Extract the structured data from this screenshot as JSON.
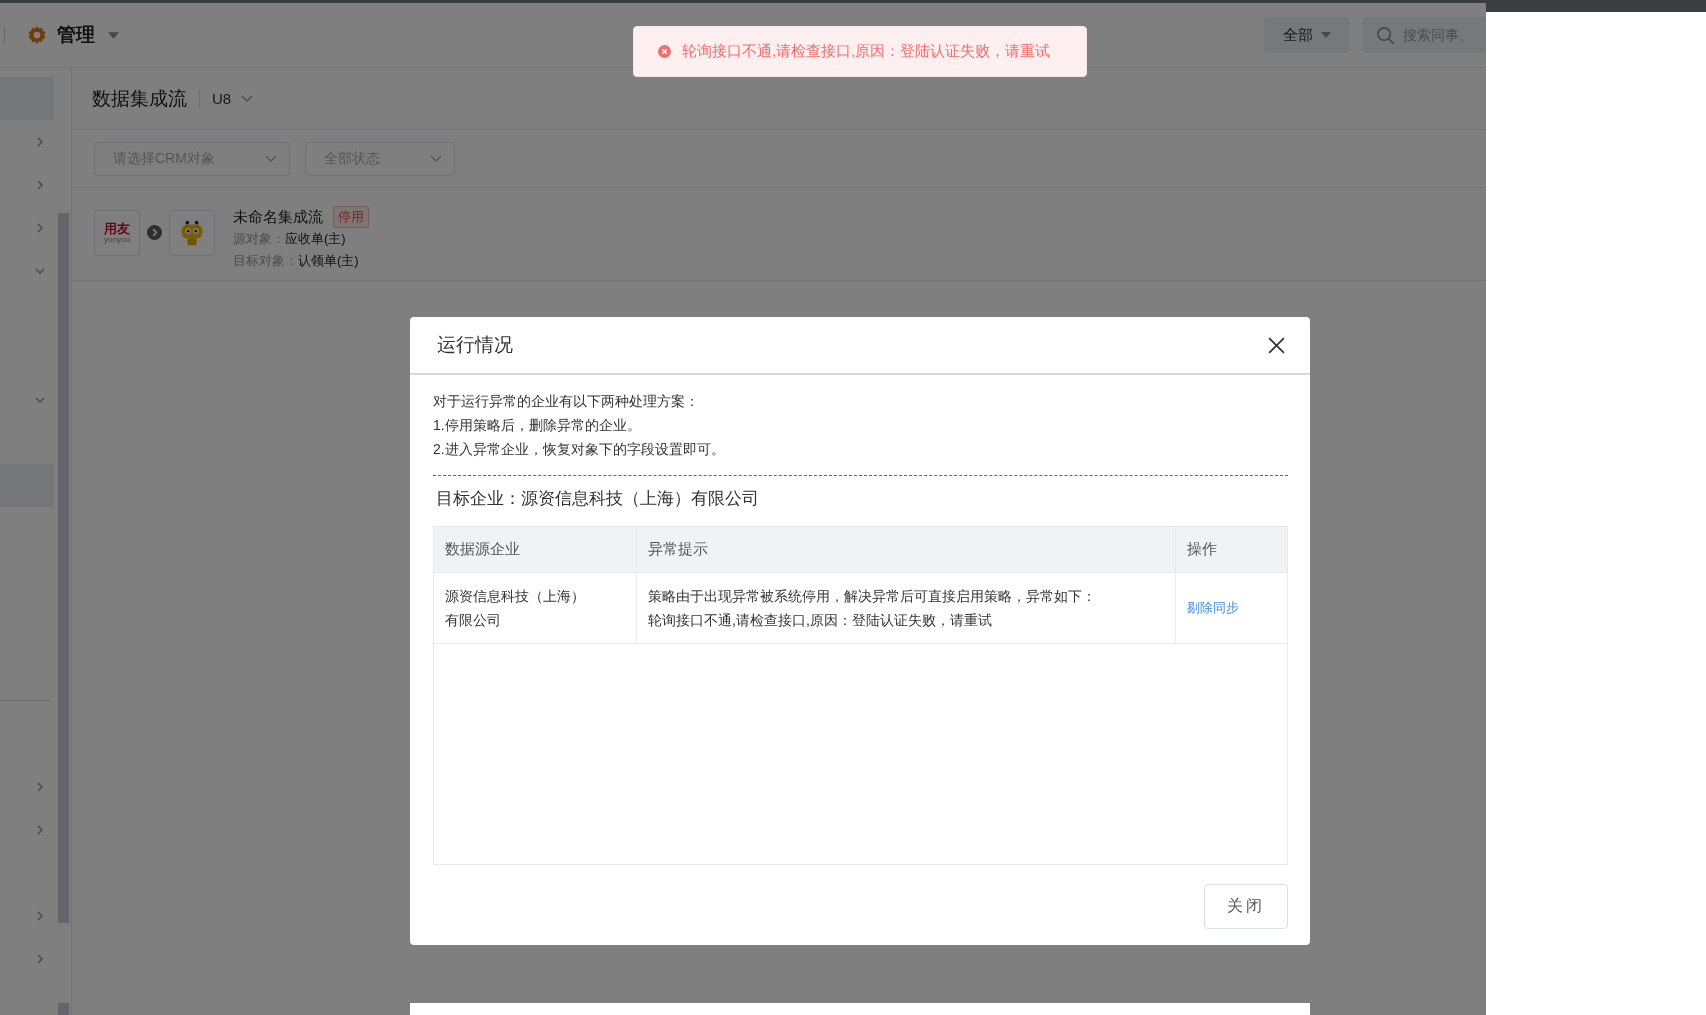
{
  "header": {
    "title": "管理",
    "scope_filter": "全部",
    "search": {
      "placeholder": "搜索同事、"
    }
  },
  "toast": {
    "kind": "error",
    "message": "轮询接口不通,请检查接口,原因：登陆认证失败，请重试"
  },
  "sidebar": {
    "items": [
      {
        "kind": "plain",
        "selected": true
      },
      {
        "kind": "group",
        "selected": false,
        "expanded": false
      },
      {
        "kind": "group",
        "selected": false,
        "expanded": false
      },
      {
        "kind": "group",
        "selected": false,
        "expanded": false
      },
      {
        "kind": "group",
        "selected": false,
        "expanded": true
      },
      {
        "kind": "plain",
        "selected": false
      },
      {
        "kind": "plain",
        "selected": false
      },
      {
        "kind": "group",
        "selected": false,
        "expanded": true
      },
      {
        "kind": "plain",
        "selected": false
      },
      {
        "kind": "plain",
        "selected": true
      },
      {
        "kind": "plain",
        "selected": false
      },
      {
        "kind": "plain",
        "selected": false
      },
      {
        "kind": "plain",
        "selected": false
      },
      {
        "kind": "plain",
        "selected": false
      },
      {
        "kind": "divider"
      },
      {
        "kind": "plain",
        "selected": false
      },
      {
        "kind": "group",
        "selected": false,
        "expanded": false
      },
      {
        "kind": "group",
        "selected": false,
        "expanded": false
      },
      {
        "kind": "plain",
        "selected": false
      },
      {
        "kind": "group",
        "selected": false,
        "expanded": false
      },
      {
        "kind": "group",
        "selected": false,
        "expanded": false
      }
    ]
  },
  "page": {
    "title": "数据集成流",
    "system": "U8",
    "filters": [
      {
        "placeholder": "请选择CRM对象"
      },
      {
        "placeholder": "全部状态"
      }
    ],
    "flows": [
      {
        "source_logo": {
          "text": "用友",
          "subtext": "yonyou"
        },
        "name": "未命名集成流",
        "status": "停用",
        "enabled": false,
        "fields": [
          {
            "label": "源对象：",
            "value": "应收单(主)"
          },
          {
            "label": "目标对象：",
            "value": "认领单(主)"
          }
        ]
      }
    ]
  },
  "dialog": {
    "title": "运行情况",
    "instructions": [
      "对于运行异常的企业有以下两种处理方案：",
      "1.停用策略后，删除异常的企业。",
      "2.进入异常企业，恢复对象下的字段设置即可。"
    ],
    "target": "目标企业：源资信息科技（上海）有限公司",
    "table": {
      "columns": [
        "数据源企业",
        "异常提示",
        "操作"
      ],
      "rows": [
        {
          "source": "源资信息科技（上海）有限公司",
          "message": "策略由于出现异常被系统停用，解决异常后可直接启用策略，异常如下：轮询接口不通,请检查接口,原因：登陆认证失败，请重试",
          "action": "剔除同步"
        }
      ]
    },
    "buttons": [
      "关闭"
    ]
  }
}
